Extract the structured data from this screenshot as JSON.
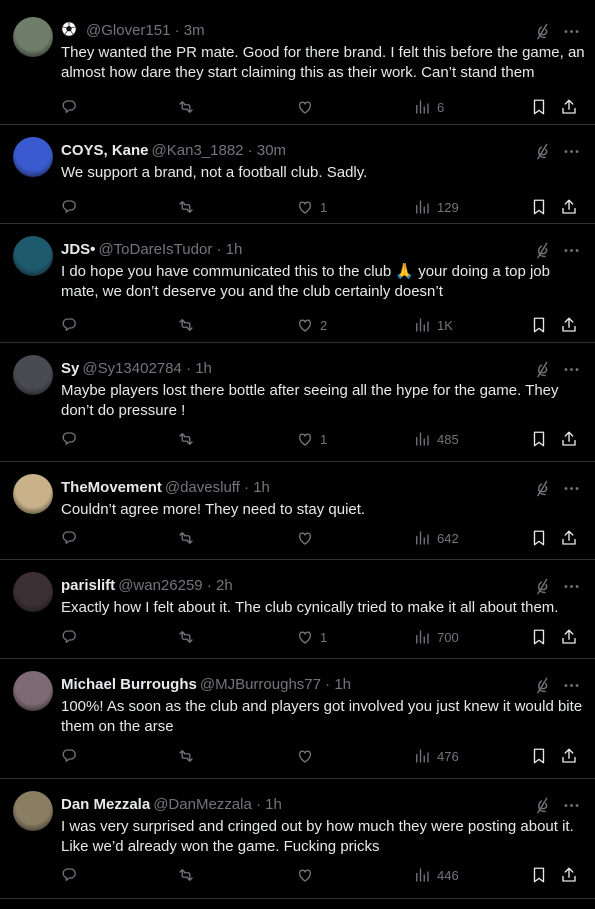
{
  "tweets": [
    {
      "name": "",
      "handle": "@Glover151",
      "time": "3m",
      "text": "They wanted the PR mate. Good for there brand. I felt this before the game, an almost how dare they start claiming this as their work. Can’t stand them",
      "replies": "",
      "reposts": "",
      "likes": "",
      "views": "6",
      "avatar_color": "#6f7d6a",
      "badge": "soccer-ball-icon"
    },
    {
      "name": "COYS, Kane",
      "handle": "@Kan3_1882",
      "time": "30m",
      "text": "We support a brand, not a football club. Sadly.",
      "replies": "",
      "reposts": "",
      "likes": "1",
      "views": "129",
      "avatar_color": "#3a5bd0"
    },
    {
      "name": "JDS•",
      "handle": "@ToDareIsTudor",
      "time": "1h",
      "text": "I do hope you have communicated this to the club 🙏 your doing a top job mate, we don’t deserve you and the club certainly doesn’t",
      "replies": "",
      "reposts": "",
      "likes": "2",
      "views": "1K",
      "avatar_color": "#1e5a6e"
    },
    {
      "name": "Sy",
      "handle": "@Sy13402784",
      "time": "1h",
      "text": "Maybe players lost there bottle after seeing all the hype for the game. They don’t do pressure !",
      "replies": "",
      "reposts": "",
      "likes": "1",
      "views": "485",
      "avatar_color": "#4a4a52"
    },
    {
      "name": "TheMovement",
      "handle": "@davesluff",
      "time": "1h",
      "text": "Couldn’t agree more! They need to stay quiet.",
      "replies": "",
      "reposts": "",
      "likes": "",
      "views": "642",
      "avatar_color": "#c9b28a"
    },
    {
      "name": "parislift",
      "handle": "@wan26259",
      "time": "2h",
      "text": "Exactly how I felt about it. The club cynically tried to make it all about them.",
      "replies": "",
      "reposts": "",
      "likes": "1",
      "views": "700",
      "avatar_color": "#3b2f33"
    },
    {
      "name": "Michael Burroughs",
      "handle": "@MJBurroughs77",
      "time": "1h",
      "text": "100%! As soon as the club and players got involved you just knew it would bite them on the arse",
      "replies": "",
      "reposts": "",
      "likes": "",
      "views": "476",
      "avatar_color": "#7d6a72"
    },
    {
      "name": "Dan Mezzala",
      "handle": "@DanMezzala",
      "time": "1h",
      "text": "I was very surprised and cringed out by how much they were posting about it. Like we’d already won the game. Fucking pricks",
      "replies": "",
      "reposts": "",
      "likes": "",
      "views": "446",
      "avatar_color": "#8a7e62"
    }
  ],
  "colors": {
    "background": "#000000",
    "text": "#e7e9ea",
    "secondary": "#71767b",
    "divider": "#2f3336"
  }
}
